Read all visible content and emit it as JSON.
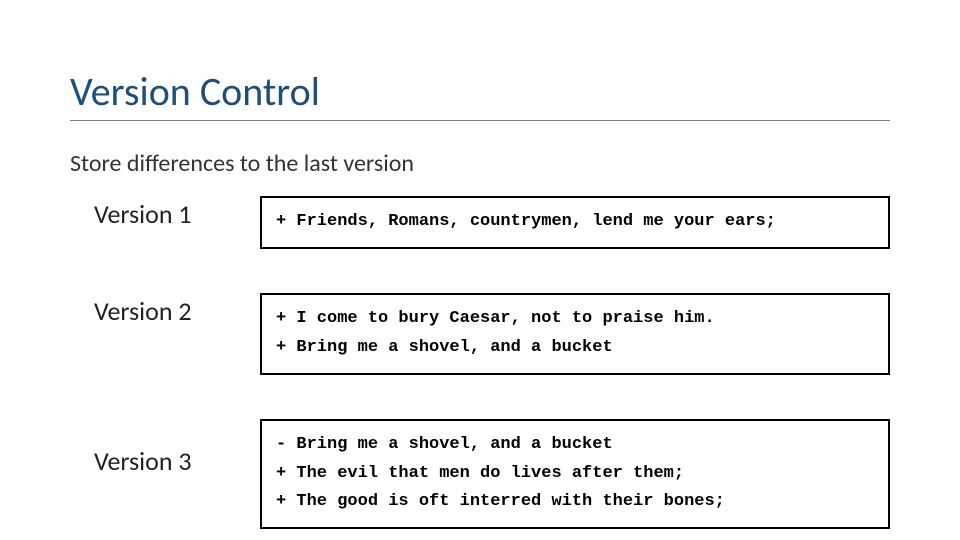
{
  "title": "Version Control",
  "subtitle": "Store differences to the last version",
  "versions": [
    {
      "label": "Version 1",
      "lines": [
        "+ Friends, Romans, countrymen, lend me your ears;"
      ]
    },
    {
      "label": "Version 2",
      "lines": [
        "+ I come to bury Caesar, not to praise him.",
        "+ Bring me a shovel, and a bucket"
      ]
    },
    {
      "label": "Version 3",
      "lines": [
        "- Bring me a shovel, and a bucket",
        "+ The evil that men do lives after them;",
        "+ The good is oft interred with their bones;"
      ]
    }
  ]
}
